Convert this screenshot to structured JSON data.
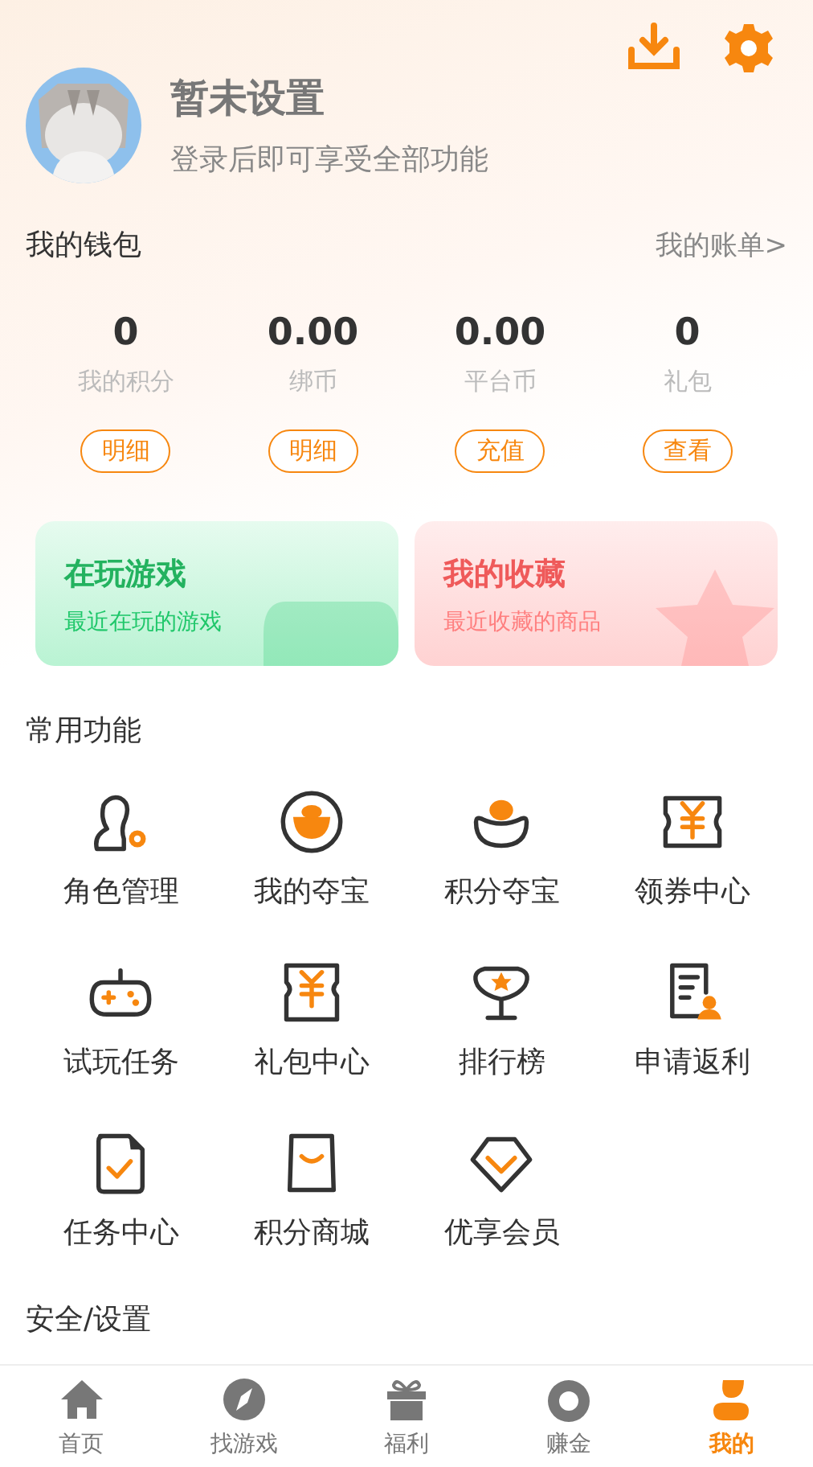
{
  "profile": {
    "name": "暂未设置",
    "hint": "登录后即可享受全部功能"
  },
  "wallet": {
    "title": "我的钱包",
    "link": "我的账单>",
    "items": [
      {
        "value": "0",
        "label": "我的积分",
        "action": "明细"
      },
      {
        "value": "0.00",
        "label": "绑币",
        "action": "明细"
      },
      {
        "value": "0.00",
        "label": "平台币",
        "action": "充值"
      },
      {
        "value": "0",
        "label": "礼包",
        "action": "查看"
      }
    ]
  },
  "cards": [
    {
      "kind": "playing",
      "title": "在玩游戏",
      "subtitle": "最近在玩的游戏"
    },
    {
      "kind": "favorites",
      "title": "我的收藏",
      "subtitle": "最近收藏的商品"
    }
  ],
  "functions": {
    "title": "常用功能",
    "items": [
      "角色管理",
      "我的夺宝",
      "积分夺宝",
      "领券中心",
      "试玩任务",
      "礼包中心",
      "排行榜",
      "申请返利",
      "任务中心",
      "积分商城",
      "优享会员"
    ]
  },
  "settings_title": "安全/设置",
  "nav": [
    {
      "label": "首页",
      "selected": false
    },
    {
      "label": "找游戏",
      "selected": false
    },
    {
      "label": "福利",
      "selected": false
    },
    {
      "label": "赚金",
      "selected": false
    },
    {
      "label": "我的",
      "selected": true
    }
  ]
}
